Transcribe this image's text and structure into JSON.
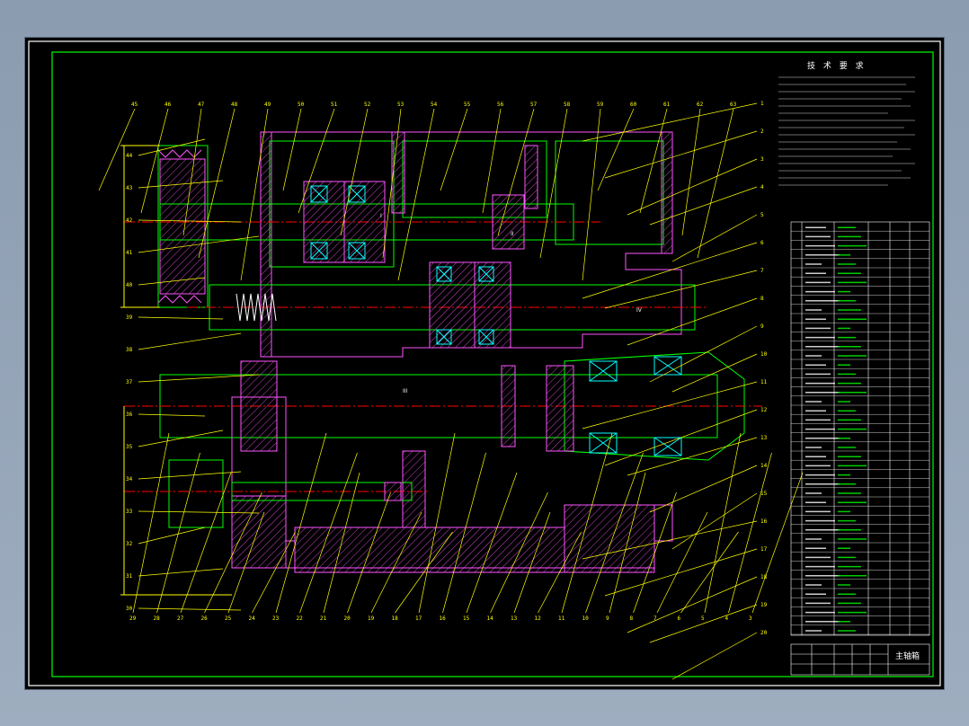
{
  "drawing": {
    "notes_title": "技 术 要 求",
    "shaft_labels": [
      "I",
      "II",
      "III",
      "IV"
    ],
    "callout_numbers_top": [
      "45",
      "46",
      "47",
      "48",
      "49",
      "50",
      "51",
      "52",
      "53",
      "54",
      "55",
      "56",
      "57",
      "58",
      "59",
      "60",
      "61",
      "62",
      "63"
    ],
    "callout_numbers_left": [
      "44",
      "43",
      "42",
      "41",
      "40",
      "39",
      "38",
      "37",
      "36",
      "35",
      "34",
      "33",
      "32",
      "31",
      "30"
    ],
    "callout_numbers_right": [
      "1",
      "2",
      "3",
      "4",
      "5",
      "6",
      "7",
      "8",
      "9",
      "10",
      "11",
      "12",
      "13",
      "14",
      "15",
      "16",
      "17",
      "18",
      "19",
      "20"
    ],
    "callout_numbers_bottom": [
      "29",
      "28",
      "27",
      "26",
      "25",
      "24",
      "23",
      "22",
      "21",
      "20",
      "19",
      "18",
      "17",
      "16",
      "15",
      "14",
      "13",
      "12",
      "11",
      "10",
      "9",
      "8",
      "7",
      "6",
      "5",
      "4",
      "3"
    ],
    "title_block_name": "主轴箱"
  },
  "colors": {
    "frame": "#00ff00",
    "section_lines": "#ff00ff",
    "centerline": "#ff0000",
    "dimensions": "#00ffff",
    "callouts": "#ffff00",
    "text": "#ffffff"
  }
}
